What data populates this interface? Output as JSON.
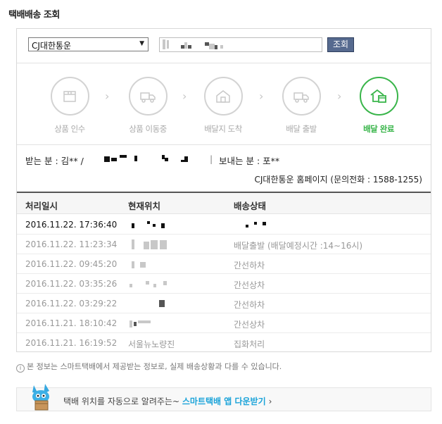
{
  "page": {
    "title": "택배배송 조회"
  },
  "search": {
    "carrier_selected": "CJ대한통운",
    "search_button_label": "조회"
  },
  "steps": [
    {
      "label": "상품 인수",
      "icon": "box-icon",
      "active": false
    },
    {
      "label": "상품 이동중",
      "icon": "truck-icon",
      "active": false
    },
    {
      "label": "배달지 도착",
      "icon": "house-icon",
      "active": false
    },
    {
      "label": "배달 출발",
      "icon": "truck-icon",
      "active": false
    },
    {
      "label": "배달 완료",
      "icon": "house-box-icon",
      "active": true
    }
  ],
  "parties": {
    "receiver_label": "받는 분 :",
    "receiver_value": "김** /",
    "sender_label": "보내는 분 :",
    "sender_value": "포**"
  },
  "carrier_info": "CJ대한통운 홈페이지 (문의전화 : 1588-1255)",
  "table": {
    "headers": [
      "처리일시",
      "현재위치",
      "배송상태"
    ],
    "rows": [
      {
        "time": "2016.11.22. 17:36:40",
        "location": "",
        "status": ""
      },
      {
        "time": "2016.11.22. 11:23:34",
        "location": "",
        "status": "배달출발 (배달예정시간 :14∼16시)"
      },
      {
        "time": "2016.11.22. 09:45:20",
        "location": "",
        "status": "간선하차"
      },
      {
        "time": "2016.11.22. 03:35:26",
        "location": "",
        "status": "간선상차"
      },
      {
        "time": "2016.11.22. 03:29:22",
        "location": "",
        "status": "간선하차"
      },
      {
        "time": "2016.11.21. 18:10:42",
        "location": "",
        "status": "간선상차"
      },
      {
        "time": "2016.11.21. 16:19:52",
        "location": "서울뉴노량진",
        "status": "집화처리"
      }
    ]
  },
  "notice": "본 정보는 스마트택배에서 제공받는 정보로, 실제 배송상황과 다를 수 있습니다.",
  "banner": {
    "text": "택배 위치를 자동으로 알려주는~",
    "link_text": "스마트택배 앱 다운받기",
    "chevron": "›"
  },
  "colors": {
    "accent_green": "#39b54a",
    "button_blue": "#566a8f",
    "link_blue": "#1aa3d9"
  }
}
